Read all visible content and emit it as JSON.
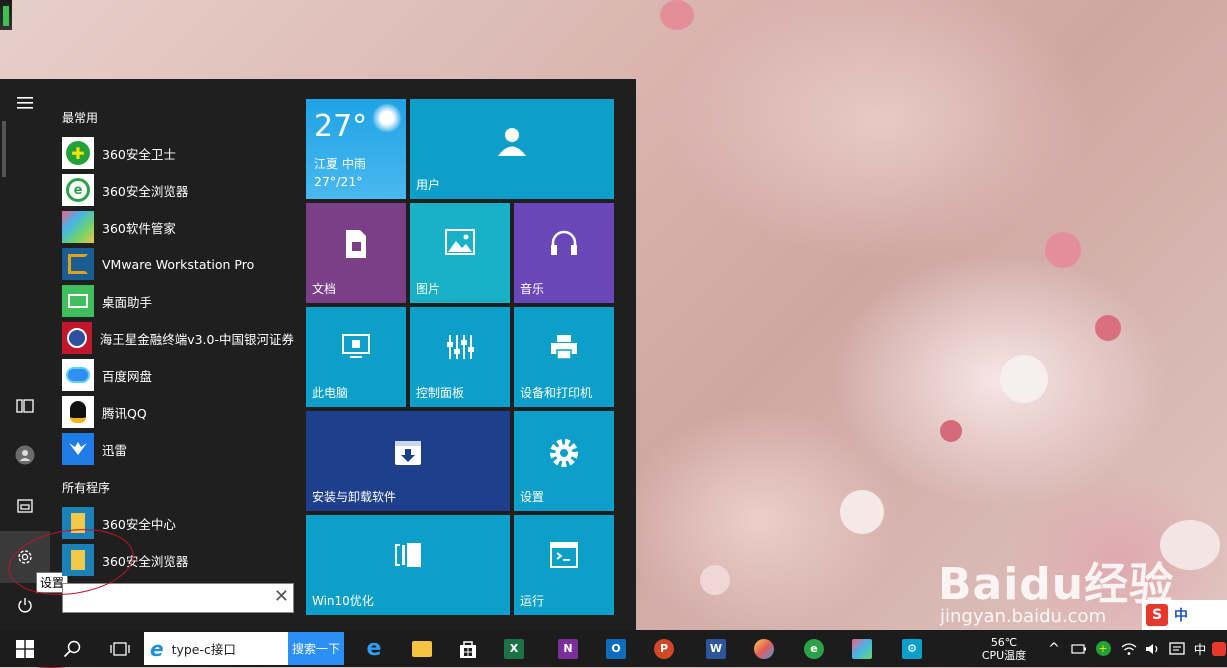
{
  "start_menu": {
    "sections": {
      "most_used": "最常用",
      "all_programs": "所有程序"
    },
    "most_used_apps": [
      {
        "label": "360安全卫士",
        "icon": "360-safeguard-icon",
        "color": "#23a23a"
      },
      {
        "label": "360安全浏览器",
        "icon": "360-browser-icon",
        "color": "#2ba245"
      },
      {
        "label": "360软件管家",
        "icon": "360-software-manager-icon",
        "color": "#3aa6d8"
      },
      {
        "label": "VMware Workstation Pro",
        "icon": "vmware-icon",
        "color": "#e0a11b"
      },
      {
        "label": "桌面助手",
        "icon": "desktop-assistant-icon",
        "color": "#3fbf5b"
      },
      {
        "label": "海王星金融终端v3.0-中国银河证券",
        "icon": "neptune-finance-icon",
        "color": "#c2162d"
      },
      {
        "label": "百度网盘",
        "icon": "baidu-netdisk-icon",
        "color": "#2f8ef0"
      },
      {
        "label": "腾讯QQ",
        "icon": "qq-icon",
        "color": "#111111"
      },
      {
        "label": "迅雷",
        "icon": "xunlei-icon",
        "color": "#1f7ce6"
      }
    ],
    "all_programs_apps": [
      {
        "label": "360安全中心",
        "icon": "folder-icon",
        "color": "#f2c84b"
      },
      {
        "label": "360安全浏览器",
        "icon": "folder-icon",
        "color": "#f2c84b"
      }
    ],
    "search_placeholder": "",
    "search_clear": "✕",
    "rail": {
      "menu": "hamburger-icon",
      "tablet": "tablet-mode-icon",
      "user": "user-avatar-icon",
      "explorer": "file-explorer-icon",
      "settings": "gear-icon",
      "power": "power-icon",
      "settings_tooltip": "设置"
    }
  },
  "tiles": {
    "weather": {
      "temp": "27°",
      "location": "江夏  中雨",
      "range": "27°/21°"
    },
    "user": "用户",
    "docs": "文档",
    "pictures": "图片",
    "music": "音乐",
    "this_pc": "此电脑",
    "control_panel": "控制面板",
    "devices_printers": "设备和打印机",
    "install_uninstall": "安装与卸载软件",
    "settings": "设置",
    "win10_opt": "Win10优化",
    "run": "运行"
  },
  "taskbar": {
    "ie_address": "type-c接口",
    "search_button": "搜索一下",
    "cpu_temp": "56℃",
    "cpu_label": "CPU温度",
    "ime": "中"
  },
  "watermark": {
    "brand": "Baidu经验",
    "url": "jingyan.baidu.com"
  },
  "colors": {
    "tile_blue": "#0c9fc9",
    "tile_purple_docs": "#7a3f86",
    "tile_teal_pictures": "#19b1c8",
    "tile_purple_music": "#6a47b8",
    "tile_darkblue": "#1d3f8c"
  }
}
